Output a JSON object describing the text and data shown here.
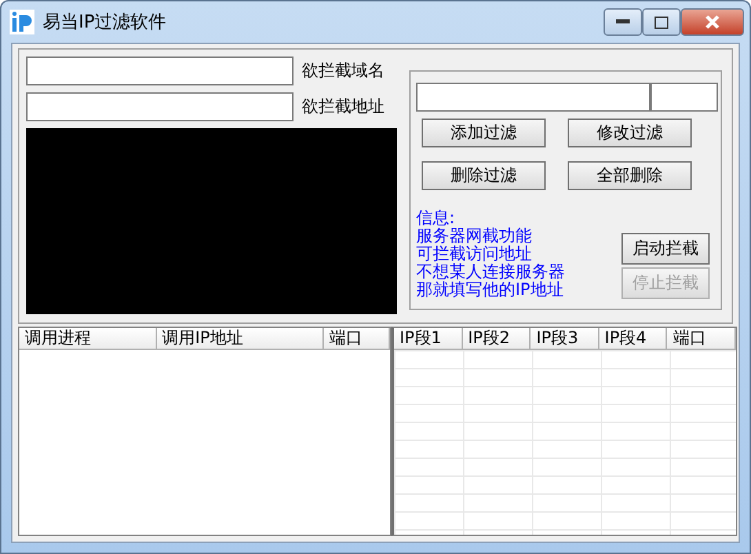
{
  "window": {
    "title": "易当IP过滤软件"
  },
  "fields": [
    {
      "label": "欲拦截域名"
    },
    {
      "label": "欲拦截地址"
    }
  ],
  "filter_buttons": [
    {
      "label": "添加过滤",
      "disabled": false
    },
    {
      "label": "修改过滤",
      "disabled": false
    },
    {
      "label": "删除过滤",
      "disabled": false
    },
    {
      "label": "全部删除",
      "disabled": false
    }
  ],
  "info": [
    "信息:",
    "服务器网截功能",
    "可拦截访问地址",
    "不想某人连接服务器",
    "那就填写他的IP地址"
  ],
  "control_buttons": [
    {
      "label": "启动拦截",
      "disabled": false
    },
    {
      "label": "停止拦截",
      "disabled": true
    }
  ],
  "process_table": {
    "columns": [
      "调用进程",
      "调用IP地址",
      "端口"
    ]
  },
  "filter_table": {
    "columns": [
      "IP段1",
      "IP段2",
      "IP段3",
      "IP段4",
      "端口"
    ]
  }
}
